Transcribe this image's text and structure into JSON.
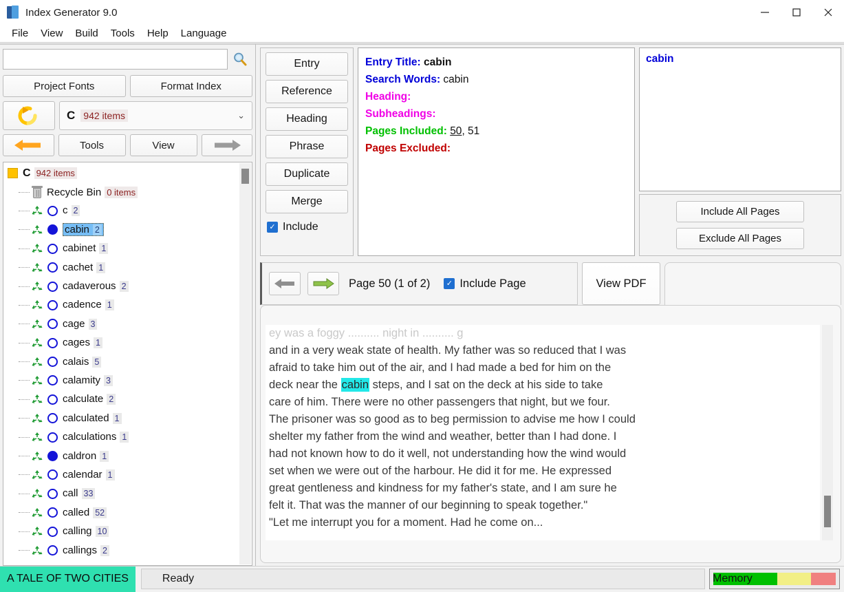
{
  "window": {
    "title": "Index Generator 9.0",
    "icon": "book-icon",
    "controls": {
      "minimize": "─",
      "maximize": "☐",
      "close": "✕"
    }
  },
  "menubar": {
    "items": [
      "File",
      "View",
      "Build",
      "Tools",
      "Help",
      "Language"
    ]
  },
  "sidebar": {
    "search": {
      "value": "",
      "placeholder": "",
      "icon": "magnifier-icon"
    },
    "project_fonts_label": "Project Fonts",
    "format_index_label": "Format Index",
    "refresh_icon": "refresh-arrow-icon",
    "letter_combo": {
      "letter": "C",
      "count": "942 items",
      "chevron": "⌄"
    },
    "back_icon": "left-arrow-icon",
    "tools_label": "Tools",
    "view_label": "View",
    "forward_icon": "right-arrow-icon",
    "tree": {
      "root": {
        "label": "C",
        "count": "942 items"
      },
      "recycle_bin": {
        "label": "Recycle Bin",
        "count": "0 items"
      },
      "items": [
        {
          "label": "c",
          "count": "2",
          "filled": false
        },
        {
          "label": "cabin",
          "count": "2",
          "filled": true,
          "selected": true
        },
        {
          "label": "cabinet",
          "count": "1",
          "filled": false
        },
        {
          "label": "cachet",
          "count": "1",
          "filled": false
        },
        {
          "label": "cadaverous",
          "count": "2",
          "filled": false
        },
        {
          "label": "cadence",
          "count": "1",
          "filled": false
        },
        {
          "label": "cage",
          "count": "3",
          "filled": false
        },
        {
          "label": "cages",
          "count": "1",
          "filled": false
        },
        {
          "label": "calais",
          "count": "5",
          "filled": false
        },
        {
          "label": "calamity",
          "count": "3",
          "filled": false
        },
        {
          "label": "calculate",
          "count": "2",
          "filled": false
        },
        {
          "label": "calculated",
          "count": "1",
          "filled": false
        },
        {
          "label": "calculations",
          "count": "1",
          "filled": false
        },
        {
          "label": "caldron",
          "count": "1",
          "filled": true
        },
        {
          "label": "calendar",
          "count": "1",
          "filled": false
        },
        {
          "label": "call",
          "count": "33",
          "filled": false
        },
        {
          "label": "called",
          "count": "52",
          "filled": false
        },
        {
          "label": "calling",
          "count": "10",
          "filled": false
        },
        {
          "label": "callings",
          "count": "2",
          "filled": false
        }
      ]
    }
  },
  "actions": {
    "buttons": [
      "Entry",
      "Reference",
      "Heading",
      "Phrase",
      "Duplicate",
      "Merge"
    ],
    "include": {
      "label": "Include",
      "checked": true
    }
  },
  "detail": {
    "entry_title_key": "Entry Title:",
    "entry_title_value": "cabin",
    "search_words_key": "Search Words:",
    "search_words_value": "cabin",
    "heading_key": "Heading:",
    "heading_value": "",
    "subheadings_key": "Subheadings:",
    "subheadings_value": "",
    "pages_included_key": "Pages Included:",
    "pages_included_first": "50",
    "pages_included_rest": ", 51",
    "pages_excluded_key": "Pages Excluded:",
    "pages_excluded_value": ""
  },
  "page_list": {
    "items": [
      "cabin"
    ],
    "include_all_label": "Include All Pages",
    "exclude_all_label": "Exclude All Pages"
  },
  "page_toolbar": {
    "prev_icon": "gray-left-arrow-icon",
    "next_icon": "green-right-arrow-icon",
    "page_label": "Page 50 (1 of 2)",
    "include_page": {
      "label": "Include Page",
      "checked": true
    },
    "view_pdf_label": "View PDF"
  },
  "text_viewer": {
    "clipped_top": "ey was a foggy .......... night in .......... g",
    "lines": [
      {
        "text": "and in a very weak state of health. My father was so reduced that I was"
      },
      {
        "text": "afraid to take him out of the air, and I had made a bed for him on the"
      },
      {
        "pre": "deck near the ",
        "highlight": "cabin",
        "post": " steps, and I sat on the deck at his side to take"
      },
      {
        "text": "care of him. There were no other passengers that night, but we four."
      },
      {
        "text": "The prisoner was so good as to beg permission to advise me how I could"
      },
      {
        "text": "shelter my father from the wind and weather, better than I had done. I"
      },
      {
        "text": "had not known how to do it well, not understanding how the wind would"
      },
      {
        "text": "set when we were out of the harbour. He did it for me. He expressed"
      },
      {
        "text": "great gentleness and kindness for my father's state, and I am sure he"
      },
      {
        "text": "felt it. That was the manner of our beginning to speak together.\""
      },
      {
        "text": "\"Let me interrupt you for a moment. Had he come on..."
      }
    ],
    "highlight_color": "#22e8e8"
  },
  "statusbar": {
    "book_title": "A TALE OF TWO CITIES",
    "status": "Ready",
    "memory_label": "Memory",
    "memory_green_pct": 52,
    "memory_yellow_pct": 28,
    "memory_red_pct": 20
  }
}
